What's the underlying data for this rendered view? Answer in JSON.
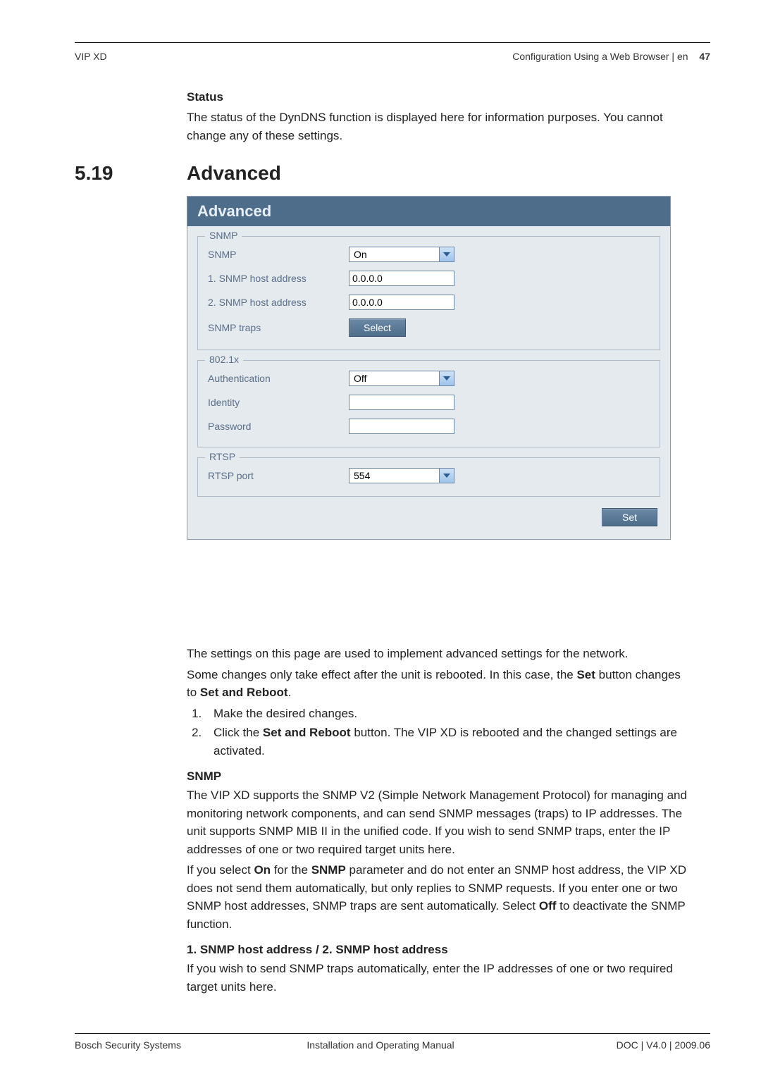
{
  "header": {
    "left": "VIP XD",
    "right_text": "Configuration Using a Web Browser | en",
    "page_number": "47"
  },
  "status_section": {
    "title": "Status",
    "body": "The status of the DynDNS function is displayed here for information purposes. You cannot change any of these settings."
  },
  "section": {
    "number": "5.19",
    "title": "Advanced"
  },
  "panel": {
    "title": "Advanced",
    "snmp": {
      "legend": "SNMP",
      "snmp_label": "SNMP",
      "snmp_value": "On",
      "host1_label": "1. SNMP host address",
      "host1_value": "0.0.0.0",
      "host2_label": "2. SNMP host address",
      "host2_value": "0.0.0.0",
      "traps_label": "SNMP traps",
      "traps_button": "Select"
    },
    "auth": {
      "legend": "802.1x",
      "auth_label": "Authentication",
      "auth_value": "Off",
      "identity_label": "Identity",
      "identity_value": "",
      "password_label": "Password",
      "password_value": ""
    },
    "rtsp": {
      "legend": "RTSP",
      "port_label": "RTSP port",
      "port_value": "554"
    },
    "set_button": "Set"
  },
  "after": {
    "intro1": "The settings on this page are used to implement advanced settings for the network.",
    "intro2_a": "Some changes only take effect after the unit is rebooted. In this case, the ",
    "intro2_b": "Set",
    "intro2_c": " button changes to ",
    "intro2_d": "Set and Reboot",
    "intro2_e": ".",
    "step1": "Make the desired changes.",
    "step2_a": "Click the ",
    "step2_b": "Set and Reboot",
    "step2_c": " button. The VIP XD is rebooted and the changed settings are activated.",
    "snmp_title": "SNMP",
    "snmp_p1": "The VIP XD supports the SNMP V2 (Simple Network Management Protocol) for managing and monitoring network components, and can send SNMP messages (traps) to IP addresses. The unit supports SNMP MIB II in the unified code. If you wish to send SNMP traps, enter the IP addresses of one or two required target units here.",
    "snmp_p2_a": "If you select ",
    "snmp_p2_b": "On",
    "snmp_p2_c": " for the ",
    "snmp_p2_d": "SNMP",
    "snmp_p2_e": " parameter and do not enter an SNMP host address, the VIP XD does not send them automatically, but only replies to SNMP requests. If you enter one or two SNMP host addresses, SNMP traps are sent automatically. Select ",
    "snmp_p2_f": "Off",
    "snmp_p2_g": " to deactivate the SNMP function.",
    "hosts_title": "1. SNMP host address / 2. SNMP host address",
    "hosts_body": "If you wish to send SNMP traps automatically, enter the IP addresses of one or two required target units here."
  },
  "footer": {
    "left": "Bosch Security Systems",
    "center": "Installation and Operating Manual",
    "right": "DOC | V4.0 | 2009.06"
  }
}
